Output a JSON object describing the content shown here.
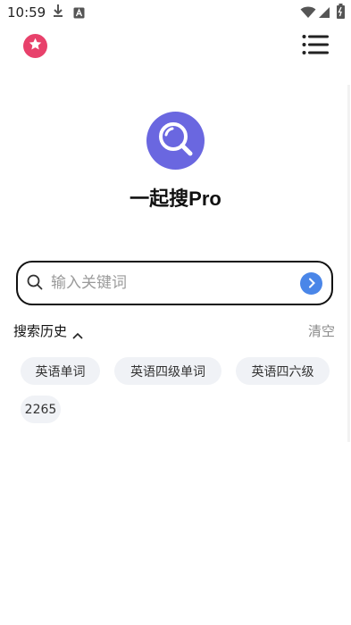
{
  "status": {
    "time": "10:59"
  },
  "app": {
    "title": "一起搜Pro"
  },
  "search": {
    "placeholder": "输入关键词"
  },
  "history": {
    "title": "搜索历史",
    "clear_label": "清空",
    "items": [
      "英语单词",
      "英语四级单词",
      "英语四六级",
      "2265"
    ]
  },
  "colors": {
    "favorite": "#e8416b",
    "logo": "#6a67e0",
    "go_button": "#4a86e8",
    "chip_bg": "#f0f2f6"
  },
  "icons": [
    "download-icon",
    "a-badge-icon",
    "wifi-icon",
    "signal-icon",
    "battery-icon",
    "star-icon",
    "menu-icon",
    "magnifier-logo-icon",
    "search-icon",
    "arrow-right-icon",
    "chevron-up-icon"
  ]
}
